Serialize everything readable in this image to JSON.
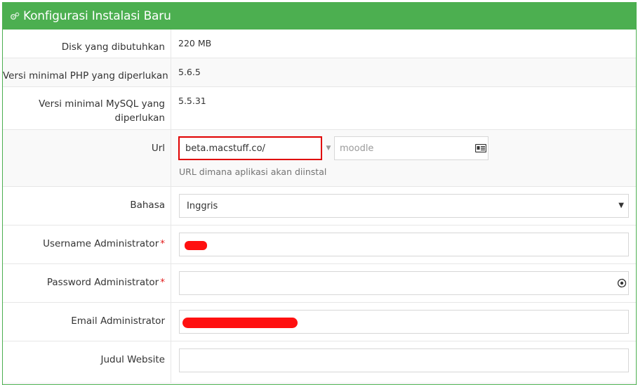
{
  "panel": {
    "title": "Konfigurasi Instalasi Baru",
    "icon": "cogs-icon",
    "accent_color": "#4caf50"
  },
  "requirements": {
    "disk_label": "Disk yang dibutuhkan",
    "disk_value": "220 MB",
    "php_label": "Versi minimal PHP yang diperlukan",
    "php_value": "5.6.5",
    "mysql_label": "Versi minimal MySQL yang diperlukan",
    "mysql_value": "5.5.31"
  },
  "url": {
    "label": "Url",
    "host_value": "beta.macstuff.co/",
    "path_placeholder": "moodle",
    "help_text": "URL dimana aplikasi akan diinstal"
  },
  "language": {
    "label": "Bahasa",
    "selected": "Inggris"
  },
  "admin_username": {
    "label": "Username Administrator",
    "required_mark": "*"
  },
  "admin_password": {
    "label": "Password Administrator",
    "required_mark": "*"
  },
  "admin_email": {
    "label": "Email Administrator"
  },
  "site_title": {
    "label": "Judul Website"
  }
}
